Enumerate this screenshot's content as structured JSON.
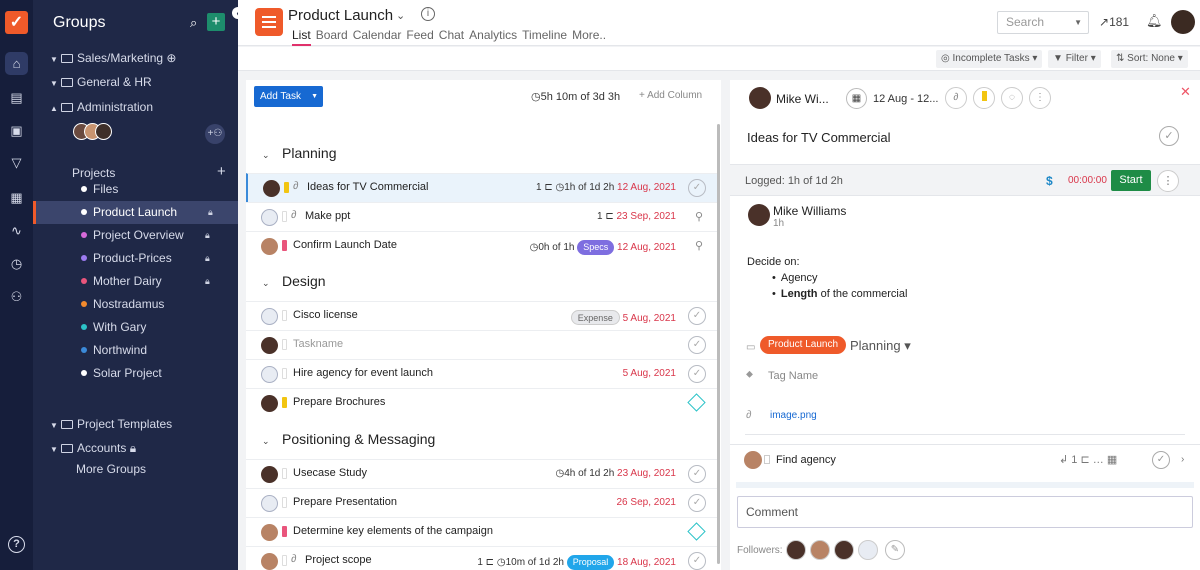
{
  "sidebar": {
    "title": "Groups",
    "groups": [
      {
        "label": "Sales/Marketing",
        "suffix": "⊕"
      },
      {
        "label": "General & HR"
      },
      {
        "label": "Administration"
      }
    ],
    "projects_label": "Projects",
    "projects": [
      {
        "label": "Files",
        "color": "#ffffff"
      },
      {
        "label": "Product Launch",
        "color": "#ffffff",
        "locked": true,
        "active": true
      },
      {
        "label": "Project Overview",
        "color": "#d66ad9",
        "locked": true
      },
      {
        "label": "Product-Prices",
        "color": "#9c7bf0",
        "locked": true
      },
      {
        "label": "Mother Dairy",
        "color": "#e9557c",
        "locked": true
      },
      {
        "label": "Nostradamus",
        "color": "#f28a2d"
      },
      {
        "label": "With Gary",
        "color": "#2cc3c8"
      },
      {
        "label": "Northwind",
        "color": "#3b8ad9"
      },
      {
        "label": "Solar Project",
        "color": "#ffffff"
      }
    ],
    "templates_label": "Project Templates",
    "accounts_label": "Accounts",
    "more_groups": "More Groups"
  },
  "header": {
    "project_title": "Product Launch",
    "tabs": [
      "List",
      "Board",
      "Calendar",
      "Feed",
      "Chat",
      "Analytics",
      "Timeline",
      "More.."
    ],
    "search_placeholder": "Search",
    "trend_count": "181"
  },
  "filters": {
    "incomplete": "Incomplete Tasks",
    "filter": "Filter",
    "sort": "Sort: None"
  },
  "list": {
    "add_task": "Add Task",
    "total_time": "5h 10m of 3d 3h",
    "add_column": "Add Column",
    "sections": [
      {
        "name": "Planning",
        "tasks": [
          {
            "name": "Ideas for TV Commercial",
            "count": "1",
            "time": "1h of 1d 2h",
            "due": "12 Aug, 2021",
            "pri": "y",
            "clip": true,
            "sel": true,
            "end": "check",
            "av": ""
          },
          {
            "name": "Make ppt",
            "count": "1",
            "due": "23 Sep, 2021",
            "pri": "",
            "clip": true,
            "end": "link",
            "av": "g"
          },
          {
            "name": "Confirm Launch Date",
            "time": "0h of 1h",
            "tag": "Specs",
            "tagc": "purple",
            "due": "12 Aug, 2021",
            "pri": "p",
            "end": "link",
            "av": "f"
          }
        ]
      },
      {
        "name": "Design",
        "tasks": [
          {
            "name": "Cisco license",
            "tag": "Expense",
            "tagc": "gray",
            "due": "5 Aug, 2021",
            "pri": "",
            "end": "check",
            "av": "g"
          },
          {
            "name": "Taskname",
            "placeholder": true,
            "end": "check",
            "av": ""
          },
          {
            "name": "Hire agency for event launch",
            "due": "5 Aug, 2021",
            "pri": "",
            "end": "check",
            "av": "g"
          },
          {
            "name": "Prepare Brochures",
            "pri": "y",
            "end": "diamond",
            "av": ""
          }
        ]
      },
      {
        "name": "Positioning & Messaging",
        "tasks": [
          {
            "name": "Usecase Study",
            "time": "4h of 1d 2h",
            "due": "23 Aug, 2021",
            "pri": "",
            "end": "check",
            "av": ""
          },
          {
            "name": "Prepare Presentation",
            "due": "26 Sep, 2021",
            "pri": "",
            "end": "check",
            "av": "g"
          },
          {
            "name": "Determine key elements of the campaign",
            "pri": "p",
            "end": "diamond",
            "av": "f"
          },
          {
            "name": "Project scope",
            "count": "1",
            "time": "10m of 1d 2h",
            "tag": "Proposal",
            "tagc": "blue",
            "due": "18 Aug, 2021",
            "pri": "",
            "clip": true,
            "end": "check",
            "av": "f"
          }
        ]
      }
    ]
  },
  "detail": {
    "assignee": "Mike Wi...",
    "date": "12 Aug - 12...",
    "title": "Ideas for TV Commercial",
    "logged": "Logged: 1h of 1d 2h",
    "dollar": "$",
    "timer": "00:00:00",
    "start": "Start",
    "commenter": "Mike Williams",
    "comment_time": "1h",
    "desc_intro": "Decide on:",
    "desc_item1": "Agency",
    "desc_item2_bold": "Length",
    "desc_item2_rest": "of the commercial",
    "project_badge": "Product Launch",
    "section": "Planning",
    "tag_placeholder": "Tag Name",
    "attachment": "image.png",
    "subtask": "Find agency",
    "subtask_count": "1",
    "comment_placeholder": "Comment",
    "followers_label": "Followers:"
  }
}
